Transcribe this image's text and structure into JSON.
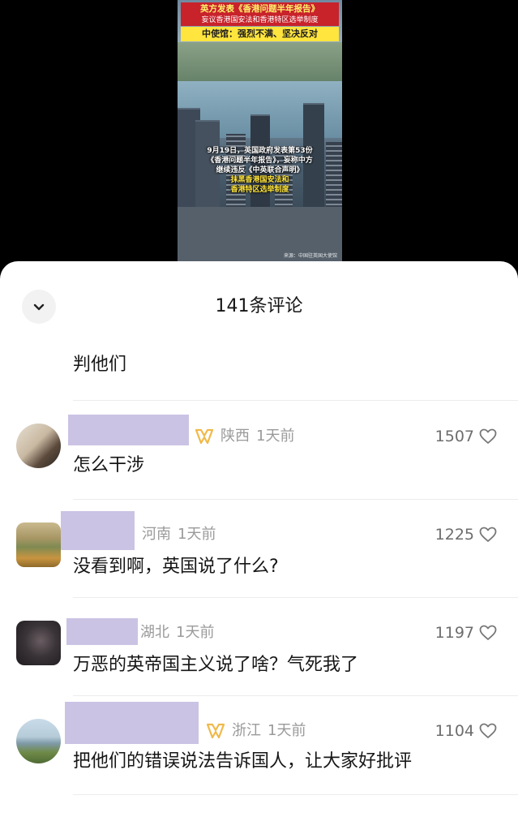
{
  "video": {
    "banner_line1": "英方发表《香港问题半年报告》",
    "banner_line2": "妄议香港国安法和香港特区选举制度",
    "banner_line3": "中使馆：强烈不满、坚决反对",
    "caption_lines": [
      "9月19日，英国政府发表第53份",
      "《香港问题半年报告》，妄称中方",
      "继续违反《中英联合声明》",
      "抹黑香港国安法和",
      "香港特区选举制度"
    ],
    "source": "来源：中国驻英国大使馆"
  },
  "sheet": {
    "title": "141条评论",
    "previous_reply": "判他们"
  },
  "comments": [
    {
      "location": "陕西",
      "time": "1天前",
      "likes": "1507",
      "text": "怎么干涉",
      "badge": true
    },
    {
      "location": "河南",
      "time": "1天前",
      "likes": "1225",
      "text": "没看到啊，英国说了什么?",
      "badge": false
    },
    {
      "location": "湖北",
      "time": "1天前",
      "likes": "1197",
      "text": "万恶的英帝国主义说了啥？气死我了",
      "badge": false
    },
    {
      "location": "浙江",
      "time": "1天前",
      "likes": "1104",
      "text": "把他们的错误说法告诉国人，让大家好批评",
      "badge": true
    }
  ],
  "colors": {
    "name_redaction": "#cbc3e4",
    "badge": "#f0b94a",
    "meta_text": "#9a9a9a"
  },
  "icons": {
    "collapse": "chevron-down-icon",
    "like": "heart-outline-icon",
    "badge": "gold-badge-icon"
  }
}
